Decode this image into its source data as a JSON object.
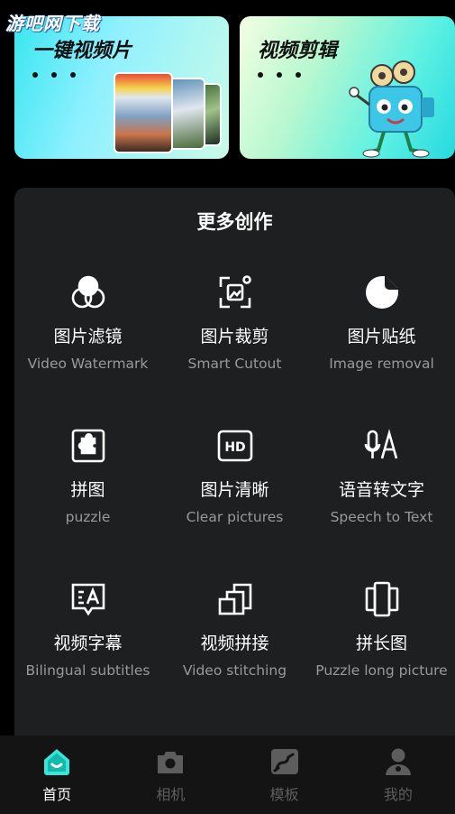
{
  "watermark": "游吧网下载",
  "cards": [
    {
      "title": "一键视频片"
    },
    {
      "title": "视频剪辑"
    }
  ],
  "panel": {
    "title": "更多创作"
  },
  "tools": [
    {
      "cn": "图片滤镜",
      "en": "Video Watermark",
      "icon": "filter-circles-icon"
    },
    {
      "cn": "图片裁剪",
      "en": "Smart Cutout",
      "icon": "crop-image-icon"
    },
    {
      "cn": "图片贴纸",
      "en": "Image removal",
      "icon": "sticker-icon"
    },
    {
      "cn": "拼图",
      "en": "puzzle",
      "icon": "puzzle-icon"
    },
    {
      "cn": "图片清晰",
      "en": "Clear pictures",
      "icon": "hd-icon"
    },
    {
      "cn": "语音转文字",
      "en": "Speech to Text",
      "icon": "speech-to-text-icon"
    },
    {
      "cn": "视频字幕",
      "en": "Bilingual subtitles",
      "icon": "subtitle-icon"
    },
    {
      "cn": "视频拼接",
      "en": "Video stitching",
      "icon": "stitching-icon"
    },
    {
      "cn": "拼长图",
      "en": "Puzzle long picture",
      "icon": "long-picture-icon"
    }
  ],
  "nav": [
    {
      "label": "首页",
      "icon": "home-icon",
      "active": true
    },
    {
      "label": "相机",
      "icon": "camera-icon",
      "active": false
    },
    {
      "label": "模板",
      "icon": "template-icon",
      "active": false
    },
    {
      "label": "我的",
      "icon": "profile-icon",
      "active": false
    }
  ],
  "colors": {
    "accent": "#3be3d8",
    "panel": "#1e1f20",
    "inactive": "#5d5d5d"
  }
}
